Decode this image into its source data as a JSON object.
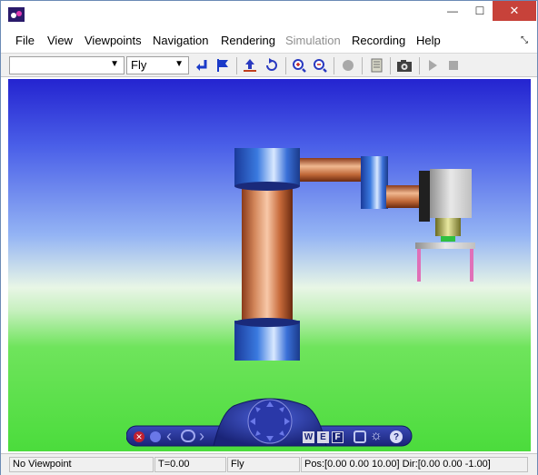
{
  "window": {
    "title": ""
  },
  "titlebar": {
    "minimize_glyph": "—",
    "maximize_glyph": "☐",
    "close_glyph": "✕"
  },
  "menu": {
    "items": [
      {
        "label": "File",
        "disabled": false
      },
      {
        "label": "View",
        "disabled": false
      },
      {
        "label": "Viewpoints",
        "disabled": false
      },
      {
        "label": "Navigation",
        "disabled": false
      },
      {
        "label": "Rendering",
        "disabled": false
      },
      {
        "label": "Simulation",
        "disabled": true
      },
      {
        "label": "Recording",
        "disabled": false
      },
      {
        "label": "Help",
        "disabled": false
      }
    ],
    "corner_glyph": "⤡"
  },
  "toolbar": {
    "viewpoint_select": {
      "value": ""
    },
    "navigation_select": {
      "value": "Fly"
    },
    "icons": [
      "return-icon",
      "flag-icon",
      "straighten-up-icon",
      "undo-move-icon",
      "zoom-in-icon",
      "zoom-out-icon",
      "headlight-icon",
      "document-icon",
      "camera-icon",
      "play-icon",
      "stop-icon"
    ]
  },
  "scene": {
    "colors": {
      "copper": "#c7673a",
      "joint_blue": "#3a7ad8",
      "gripper_gray": "#c8c8c8",
      "finger_pink": "#e070b8"
    }
  },
  "navpanel": {
    "buttons": {
      "w": "W",
      "e": "E",
      "f": "F",
      "help": "?"
    }
  },
  "status": {
    "viewpoint": "No Viewpoint",
    "time": "T=0.00",
    "mode": "Fly",
    "position": "Pos:[0.00 0.00 10.00] Dir:[0.00 0.00 -1.00]"
  }
}
